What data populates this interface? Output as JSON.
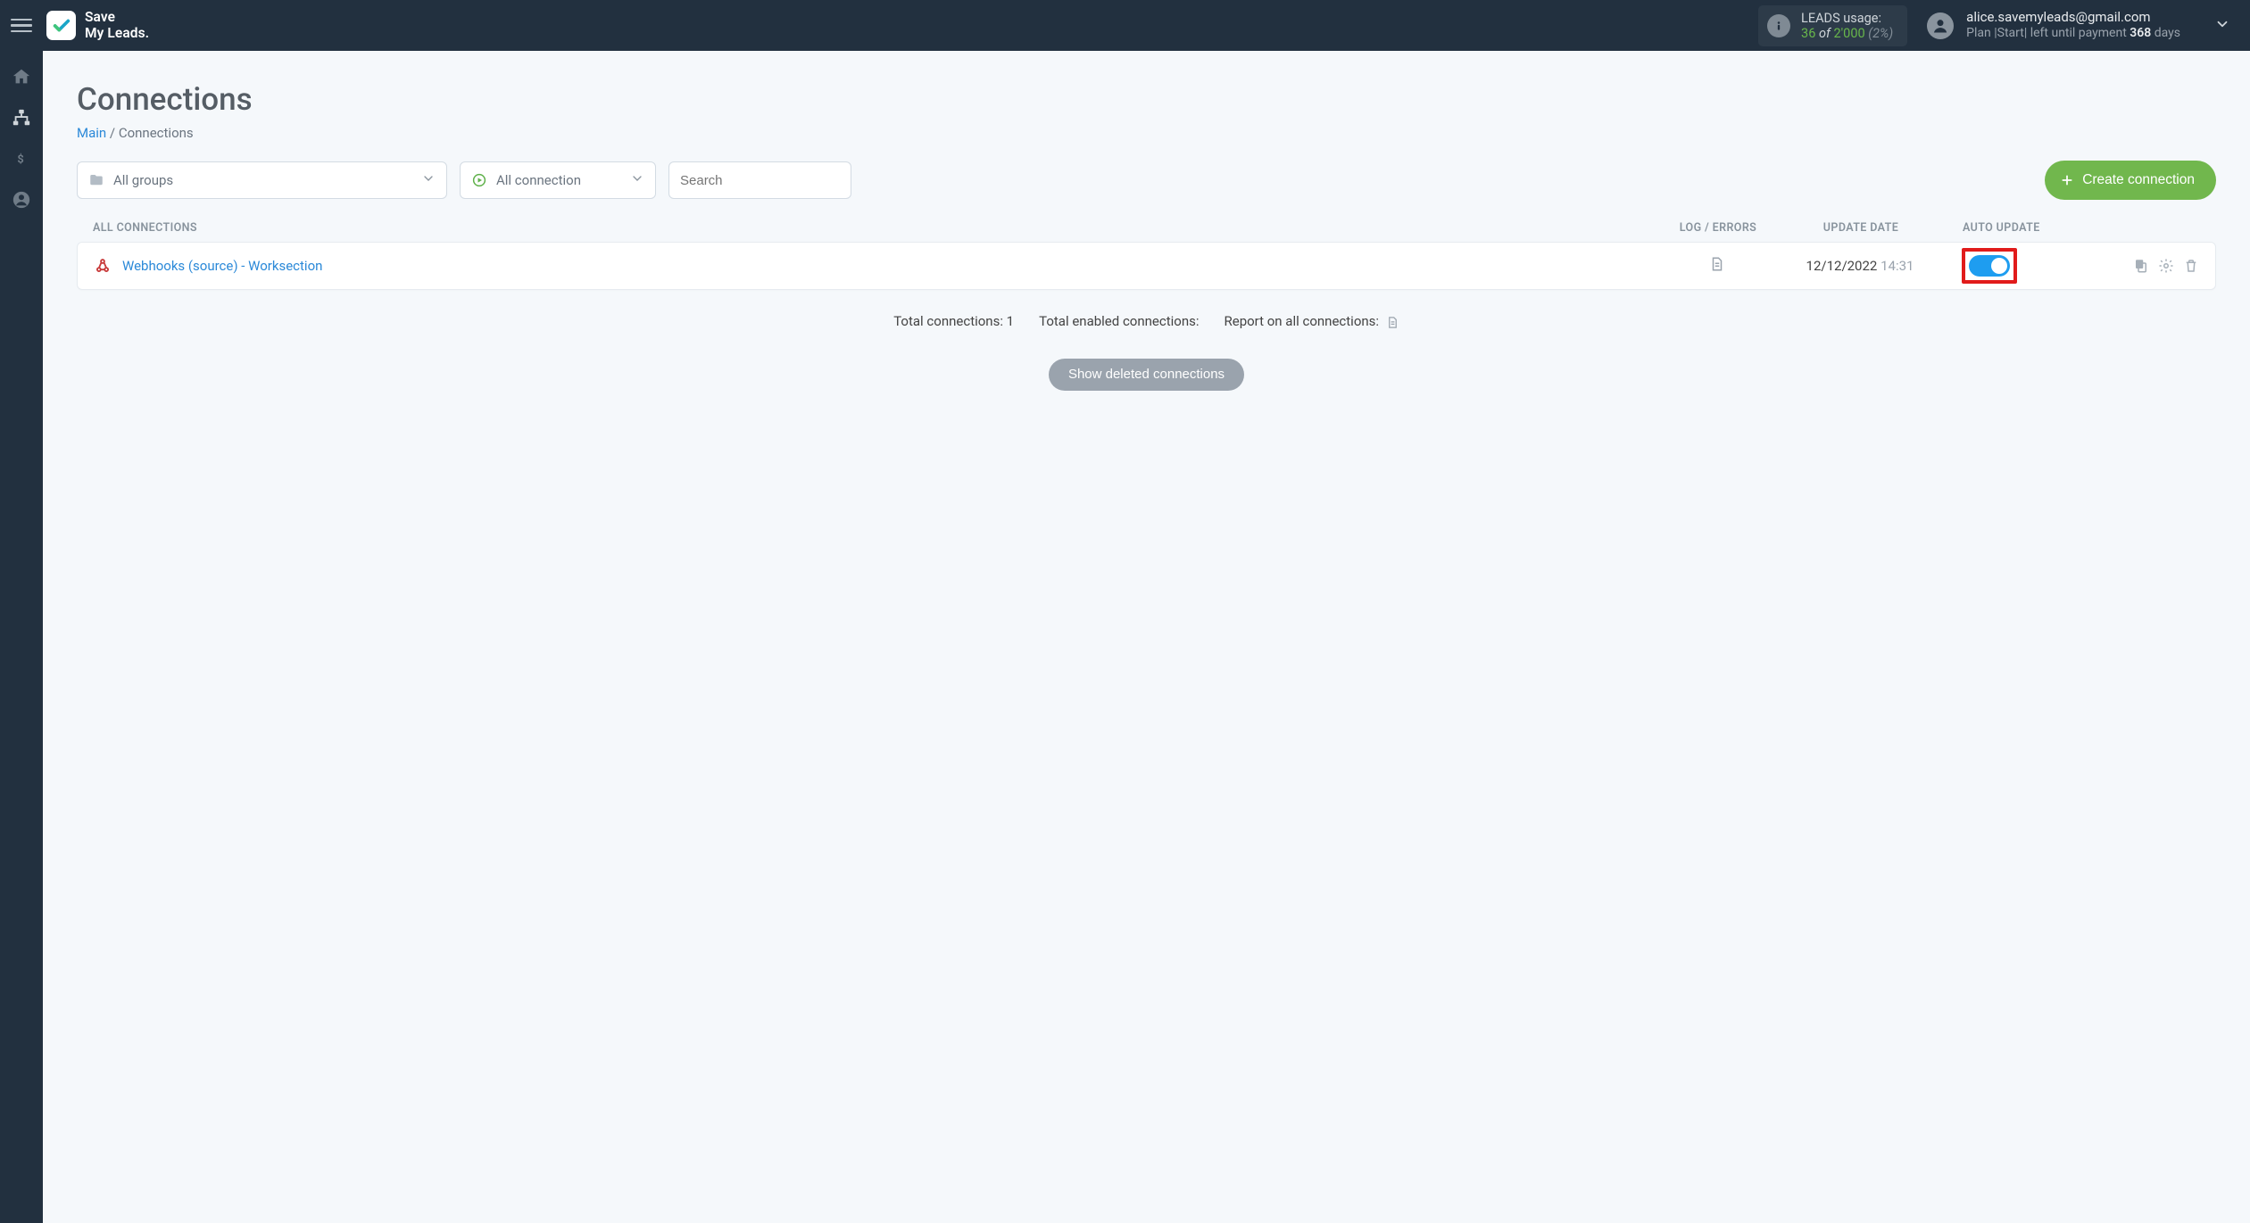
{
  "brand": {
    "line1": "Save",
    "line2": "My Leads."
  },
  "usage": {
    "title": "LEADS usage:",
    "current": "36",
    "of": "of",
    "max": "2'000",
    "pct": "(2%)"
  },
  "account": {
    "email": "alice.savemyleads@gmail.com",
    "plan_prefix": "Plan ",
    "plan_name": "|Start|",
    "plan_mid": " left until payment ",
    "days_num": "368",
    "days_word": " days"
  },
  "page": {
    "title": "Connections",
    "breadcrumb_main": "Main",
    "breadcrumb_sep": " / ",
    "breadcrumb_current": "Connections"
  },
  "filters": {
    "groups_label": "All groups",
    "status_label": "All connection",
    "search_placeholder": "Search"
  },
  "buttons": {
    "create": "Create connection",
    "show_deleted": "Show deleted connections"
  },
  "columns": {
    "name": "All connections",
    "log": "Log / Errors",
    "date": "Update Date",
    "auto": "Auto Update"
  },
  "rows": [
    {
      "name": "Webhooks (source) - Worksection",
      "date": "12/12/2022",
      "time": "14:31",
      "enabled": true
    }
  ],
  "summary": {
    "total": "Total connections: 1",
    "enabled": "Total enabled connections:",
    "report": "Report on all connections:"
  }
}
